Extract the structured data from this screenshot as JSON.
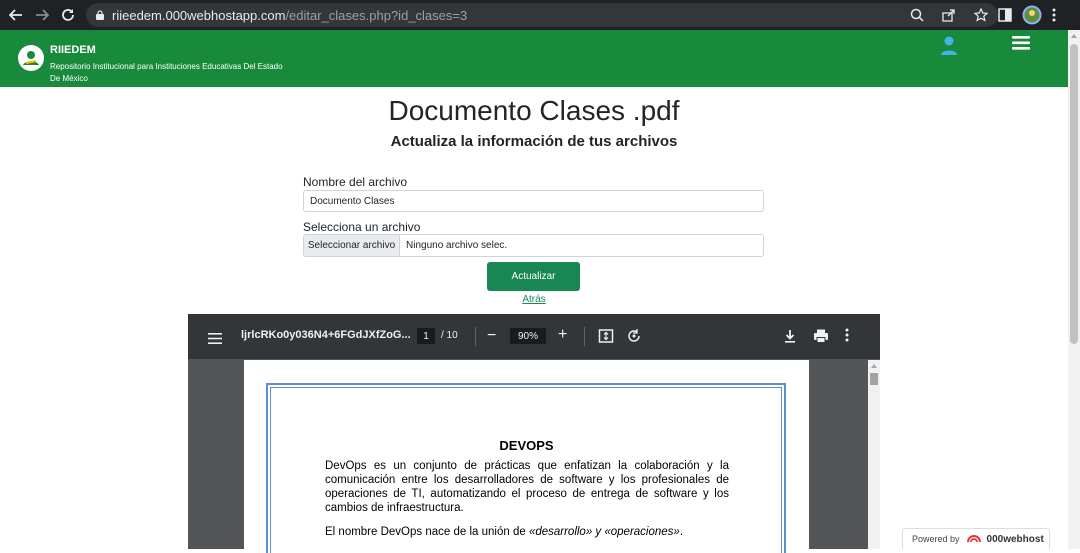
{
  "browser": {
    "url_host": "riieedem.000webhostapp.com",
    "url_path": "/editar_clases.php?id_clases=3"
  },
  "site": {
    "brand": "RIIEDEM",
    "subtitle": "Repositorio Institucional para Instituciones Educativas Del Estado De México"
  },
  "form": {
    "title": "Documento Clases .pdf",
    "subtitle": "Actualiza la información de tus archivos",
    "name_label": "Nombre del archivo",
    "name_value": "Documento Clases",
    "file_label": "Selecciona un archivo",
    "file_button": "Seleccionar archivo",
    "file_status": "Ninguno archivo selec.",
    "submit": "Actualizar",
    "back": "Atrás"
  },
  "pdf_viewer": {
    "filename": "ljrlcRKo0y036N4+6FGdJXfZoG...",
    "current_page": "1",
    "total_pages": "/ 10",
    "zoom": "90%",
    "zoom_out": "−",
    "zoom_in": "+",
    "doc_title": "DEVOPS",
    "doc_para1": "DevOps es un conjunto de prácticas que enfatizan la colaboración y la comunicación entre los desarrolladores de software y los profesionales de operaciones de TI, automatizando el proceso de entrega de software y los cambios de infraestructura.",
    "doc_para2_a": "El nombre DevOps nace de la unión de ",
    "doc_para2_b": "«desarrollo» y «operaciones»",
    "doc_para2_c": "."
  },
  "badge": {
    "powered": "Powered by",
    "name": "000webhost"
  }
}
